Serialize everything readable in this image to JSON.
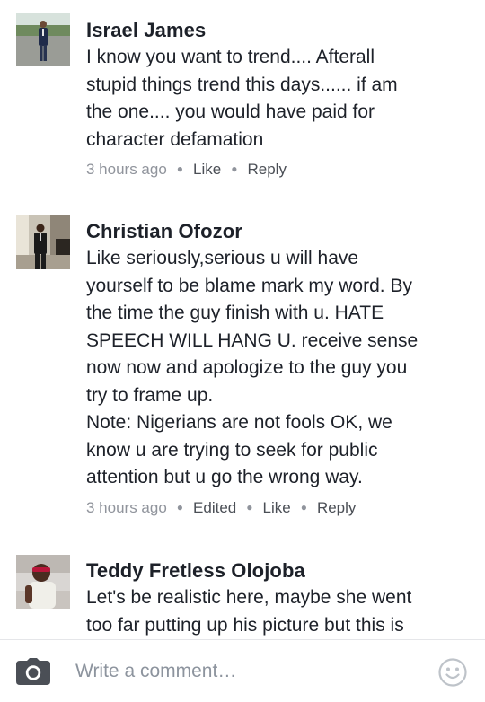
{
  "comments": [
    {
      "author": "Israel James",
      "text": "I know you want to trend.... Afterall\nstupid things trend this days...... if am\nthe one.... you would have paid for\ncharacter defamation",
      "time": "3 hours ago",
      "actions": [
        "Like",
        "Reply"
      ]
    },
    {
      "author": "Christian Ofozor",
      "text": "Like seriously,serious u will have\nyourself to be blame mark my word. By\nthe time the guy finish with u.  HATE\nSPEECH WILL HANG U. receive sense\nnow now and apologize to the guy you\ntry to frame up.\nNote: Nigerians are not fools OK,  we\nknow u are trying  to seek for public\nattention but u go the wrong way.",
      "time": "3 hours ago",
      "actions": [
        "Edited",
        "Like",
        "Reply"
      ]
    },
    {
      "author": "Teddy Fretless Olojoba",
      "text": "Let's be realistic here, maybe she went\ntoo far putting up his picture but this is"
    }
  ],
  "composer": {
    "placeholder": "Write a comment…",
    "camera_icon": "camera-icon",
    "emoji_icon": "smiley-icon"
  },
  "colors": {
    "text": "#1d2129",
    "meta_grey": "#90949c",
    "link_grey": "#4b4f56",
    "divider": "#e5e6e9"
  }
}
